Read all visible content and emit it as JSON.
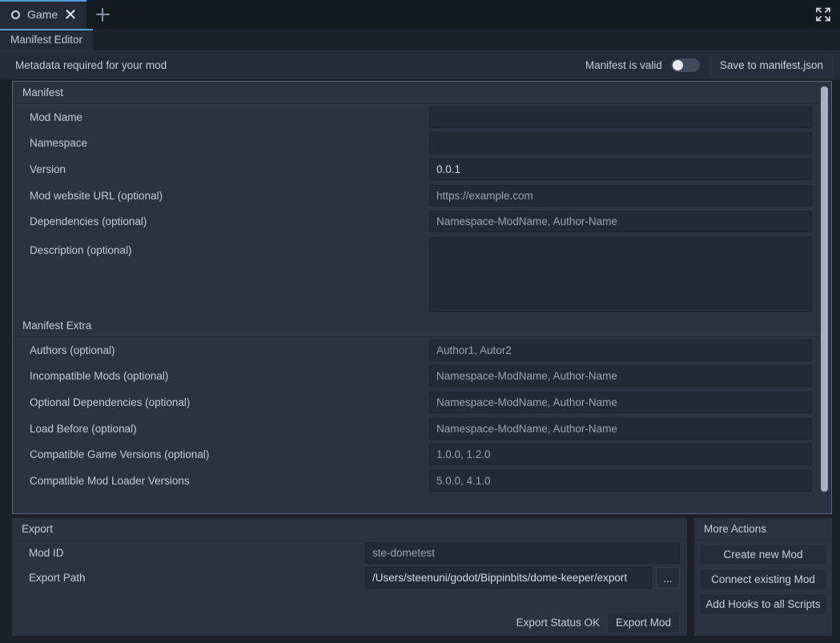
{
  "window": {
    "tab_label": "Game",
    "tab_icon": "ring-icon",
    "close_icon": "close-icon",
    "new_tab_icon": "plus-icon",
    "expand_icon": "fullscreen-icon"
  },
  "editor": {
    "tab_label": "Manifest Editor"
  },
  "header": {
    "note": "Metadata required for your mod",
    "valid_label": "Manifest is valid",
    "valid_toggle_on": false,
    "save_label": "Save to manifest.json"
  },
  "manifest": {
    "section_title": "Manifest",
    "rows": [
      {
        "label": "Mod Name",
        "value": "",
        "placeholder": ""
      },
      {
        "label": "Namespace",
        "value": "",
        "placeholder": ""
      },
      {
        "label": "Version",
        "value": "0.0.1",
        "placeholder": ""
      },
      {
        "label": "Mod website URL (optional)",
        "value": "",
        "placeholder": "https://example.com"
      },
      {
        "label": "Dependencies (optional)",
        "value": "",
        "placeholder": "Namespace-ModName, Author-Name"
      },
      {
        "label": "Description (optional)",
        "value": "",
        "placeholder": ""
      }
    ]
  },
  "manifest_extra": {
    "section_title": "Manifest Extra",
    "rows": [
      {
        "label": "Authors (optional)",
        "value": "",
        "placeholder": "Author1, Autor2"
      },
      {
        "label": "Incompatible Mods (optional)",
        "value": "",
        "placeholder": "Namespace-ModName, Author-Name"
      },
      {
        "label": "Optional Dependencies (optional)",
        "value": "",
        "placeholder": "Namespace-ModName, Author-Name"
      },
      {
        "label": "Load Before (optional)",
        "value": "",
        "placeholder": "Namespace-ModName, Author-Name"
      },
      {
        "label": "Compatible Game Versions (optional)",
        "value": "",
        "placeholder": "1.0.0, 1.2.0"
      },
      {
        "label": "Compatible Mod Loader Versions",
        "value": "",
        "placeholder": "5.0.0, 4.1.0"
      }
    ]
  },
  "export": {
    "section_title": "Export",
    "mod_id_label": "Mod ID",
    "mod_id_value": "ste-dometest",
    "export_path_label": "Export Path",
    "export_path_value": "/Users/steenuni/godot/Bippinbits/dome-keeper/export",
    "browse_label": "...",
    "status_text": "Export Status OK",
    "export_button": "Export Mod"
  },
  "more_actions": {
    "section_title": "More Actions",
    "buttons": [
      "Create new Mod",
      "Connect existing Mod",
      "Add Hooks to all Scripts"
    ]
  },
  "colors": {
    "accent": "#4e9bd8",
    "window_bg": "#14181f",
    "panel_bg": "#2b3340",
    "field_bg": "#232a35",
    "text": "#c3cad5",
    "placeholder": "#9aa3b2"
  }
}
